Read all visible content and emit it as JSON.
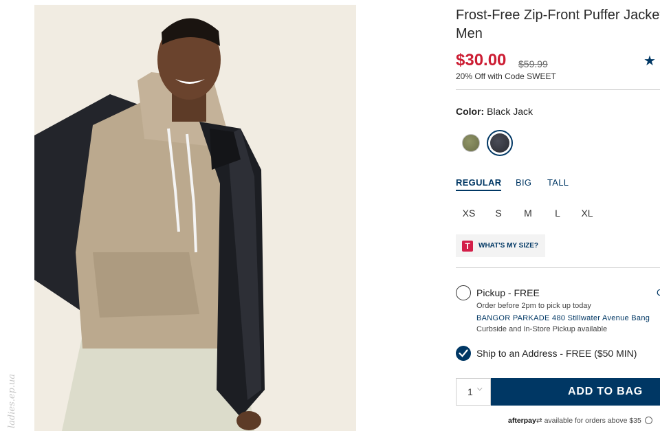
{
  "watermark": "ladies.ep.ua",
  "product": {
    "title_line1": "Frost-Free Zip-Front Puffer Jacket for",
    "title_line2": "Men",
    "price": "$30.00",
    "original_price": "$59.99",
    "promo": "20% Off with Code SWEET",
    "rating_star": "★"
  },
  "color": {
    "label": "Color:",
    "value": "Black Jack",
    "swatches": [
      "olive",
      "black-jack"
    ]
  },
  "fit_tabs": [
    "REGULAR",
    "BIG",
    "TALL"
  ],
  "active_fit": "REGULAR",
  "sizes": [
    "XS",
    "S",
    "M",
    "L",
    "XL"
  ],
  "size_guide": {
    "icon_letter": "T",
    "label": "WHAT'S MY SIZE?"
  },
  "fulfillment": {
    "pickup_label": "Pickup - FREE",
    "pickup_change": "C",
    "pickup_note": "Order before 2pm to pick up today",
    "store": "BANGOR PARKADE 480 Stillwater Avenue  Bang",
    "store_note": "Curbside and In-Store Pickup available",
    "ship_label": "Ship to an Address - FREE ($50 MIN)",
    "selected": "ship"
  },
  "cart": {
    "quantity": "1",
    "add_label": "ADD TO BAG"
  },
  "afterpay": {
    "logo": "afterpay",
    "text": " available for orders above $35"
  },
  "colors": {
    "brand_navy": "#003764",
    "sale_red": "#cc1d33",
    "size_icon_red": "#d31f49"
  }
}
